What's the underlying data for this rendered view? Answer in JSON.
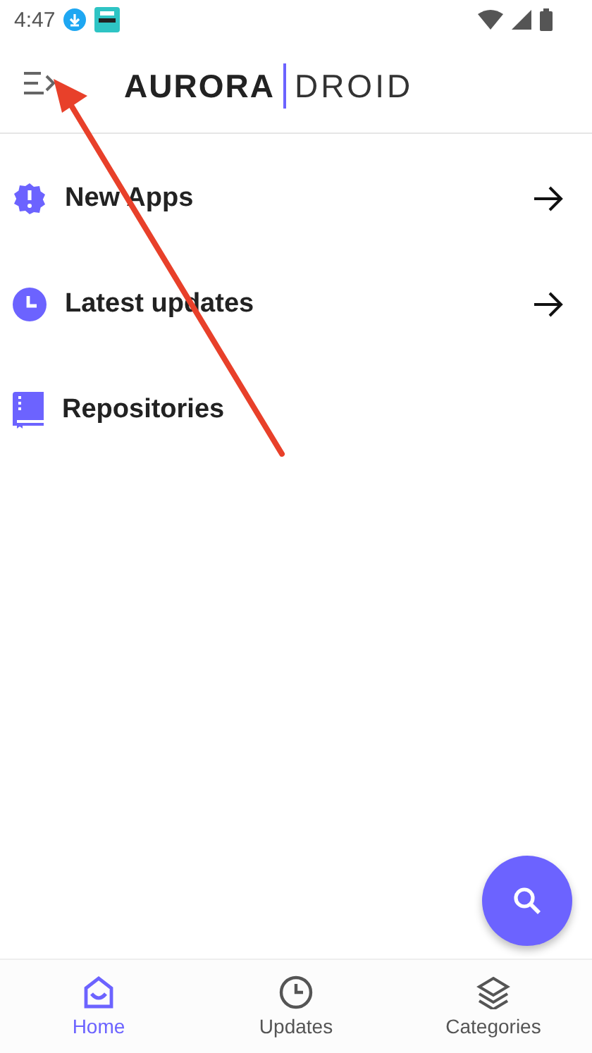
{
  "status_bar": {
    "time": "4:47"
  },
  "app_bar": {
    "logo_bold": "AURORA",
    "logo_light": "DROID"
  },
  "menu": [
    {
      "label": "New Apps",
      "kind": "badge",
      "arrow": true
    },
    {
      "label": "Latest updates",
      "kind": "clock",
      "arrow": true
    },
    {
      "label": "Repositories",
      "kind": "book",
      "arrow": false
    }
  ],
  "bottom_nav": [
    {
      "label": "Home",
      "kind": "home",
      "selected": true
    },
    {
      "label": "Updates",
      "kind": "clock",
      "selected": false
    },
    {
      "label": "Categories",
      "kind": "layers",
      "selected": false
    }
  ]
}
